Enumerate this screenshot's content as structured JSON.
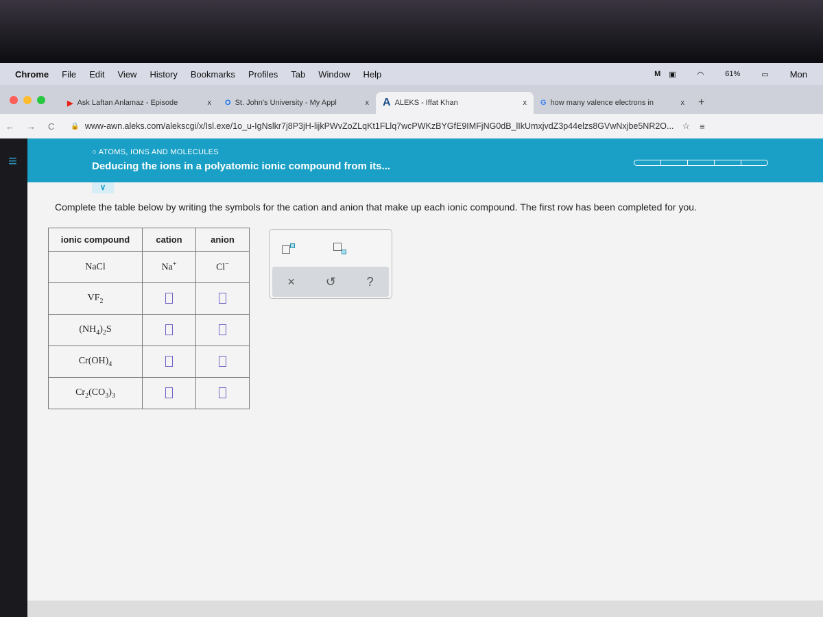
{
  "menubar": {
    "app": "Chrome",
    "items": [
      "File",
      "Edit",
      "View",
      "History",
      "Bookmarks",
      "Profiles",
      "Tab",
      "Window",
      "Help"
    ],
    "battery": "61%",
    "clock": "Mon"
  },
  "tabs": [
    {
      "label": "Ask Laftan Anlamaz - Episode",
      "icon": "youtube-icon",
      "color": "#e62117"
    },
    {
      "label": "St. John's University - My Appl",
      "icon": "circle-o-icon",
      "color": "#1a73e8"
    },
    {
      "label": "ALEKS - Iffat Khan",
      "icon": "aleks-a-icon",
      "color": "#1a4e8a",
      "active": true
    },
    {
      "label": "how many valence electrons in",
      "icon": "google-icon",
      "color": "#4285f4"
    }
  ],
  "tab_close": "x",
  "new_tab": "+",
  "address": {
    "url": "www-awn.aleks.com/alekscgi/x/Isl.exe/1o_u-IgNslkr7j8P3jH-lijkPWvZoZLqKt1FLlq7wcPWKzBYGfE9IMFjNG0dB_lIkUmxjvdZ3p44elzs8GVwNxjbe5NR2O..."
  },
  "header": {
    "topic": "ATOMS, IONS AND MOLECULES",
    "title": "Deducing the ions in a polyatomic ionic compound from its...",
    "progress_segments": 5,
    "accent": "#1aa0c6"
  },
  "instructions": "Complete the table below by writing the symbols for the cation and anion that make up each ionic compound. The first row has been completed for you.",
  "table": {
    "headers": [
      "ionic compound",
      "cation",
      "anion"
    ],
    "rows": [
      {
        "compound": "NaCl",
        "cation": "Na",
        "cation_charge": "+",
        "anion": "Cl",
        "anion_charge": "−"
      },
      {
        "compound": "VF",
        "compound_sub": "2"
      },
      {
        "compound": "(NH",
        "compound_sub": "4",
        "compound_tail": ")",
        "compound_sub2": "2",
        "compound_end": "S"
      },
      {
        "compound": "Cr(OH)",
        "compound_sub": "4"
      },
      {
        "compound": "Cr",
        "compound_sub": "2",
        "compound_tail": "(CO",
        "compound_sub2": "3",
        "compound_end": ")",
        "compound_sub3": "3"
      }
    ]
  },
  "tools": {
    "close": "×",
    "undo": "↺",
    "help": "?"
  }
}
